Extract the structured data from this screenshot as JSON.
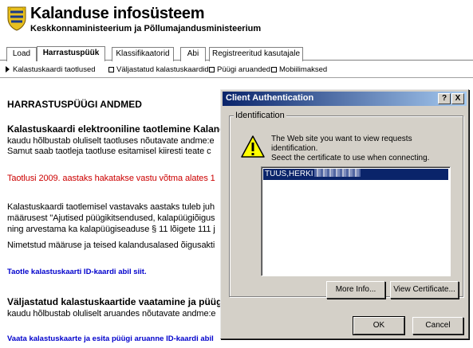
{
  "header": {
    "title": "Kalanduse infosüsteem",
    "subtitle": "Keskkonnaministeerium ja Põllumajandusministeerium"
  },
  "tabs": [
    {
      "label": "Load"
    },
    {
      "label": "Harrastuspüük",
      "active": true
    },
    {
      "label": "Klassifikaatorid"
    },
    {
      "label": "Abi"
    },
    {
      "label": "Registreeritud kasutajale"
    }
  ],
  "subnav": {
    "items": [
      {
        "label": "Kalastuskaardi taotlused"
      },
      {
        "label": "Väljastatud kalastuskaardid"
      },
      {
        "label": "Püügi aruanded"
      },
      {
        "label": "Mobiilimaksed"
      }
    ]
  },
  "main": {
    "section_title": "HARRASTUSPÜÜGI ANDMED",
    "heading1": "Kalastuskaardi elektrooniline taotlemine Kalandus",
    "para1_line1": "kaudu hõlbustab oluliselt taotluses nõutavate andme:e",
    "para1_line2": "Samut  saab taotleja taotluse esitamisel kiiresti teate c",
    "red_notice": "Taotlusi 2009. aastaks hakatakse vastu võtma alates 1",
    "para2_line1": "Kalastuskaardi taotlemisel vastavaks aastaks tuleb juh",
    "para2_line2": "määrusest \"Ajutised püügikitsendused, kalapüügiõigus",
    "para2_line3": "ning arvestama ka kalapüügiseaduse § 11 lõigete 111 j",
    "para3": "Nimetstud määruse ja teised kalandusalased õigusakti",
    "link1": "Taotle kalastuskaarti ID-kaardi abil siit.",
    "heading2": "Väljastatud kalastuskaartide vaatamine ja püügi a",
    "para4": "kaudu hõlbustab oluliselt aruandes nõutavate andme:e",
    "link2": "Vaata kalastuskaarte ja esita püügi aruanne ID-kaardi abil"
  },
  "dialog": {
    "title": "Client Authentication",
    "help_label": "?",
    "close_label": "X",
    "group_label": "Identification",
    "message_line1": "The Web site you want to view requests identification.",
    "message_line2": "Sеect the certificate to use when connecting.",
    "certificate_item": "TUUS,HERKI",
    "more_info_label": "More Info...",
    "view_cert_label": "View Certificate...",
    "ok_label": "OK",
    "cancel_label": "Cancel",
    "titlebar_color": "#0a246a",
    "selection_color": "#0a246a",
    "icon": "warning-icon"
  },
  "colors": {
    "notice_red": "#cc0000",
    "link_blue": "#0000cc",
    "dialog_gray": "#d4d0c8"
  }
}
